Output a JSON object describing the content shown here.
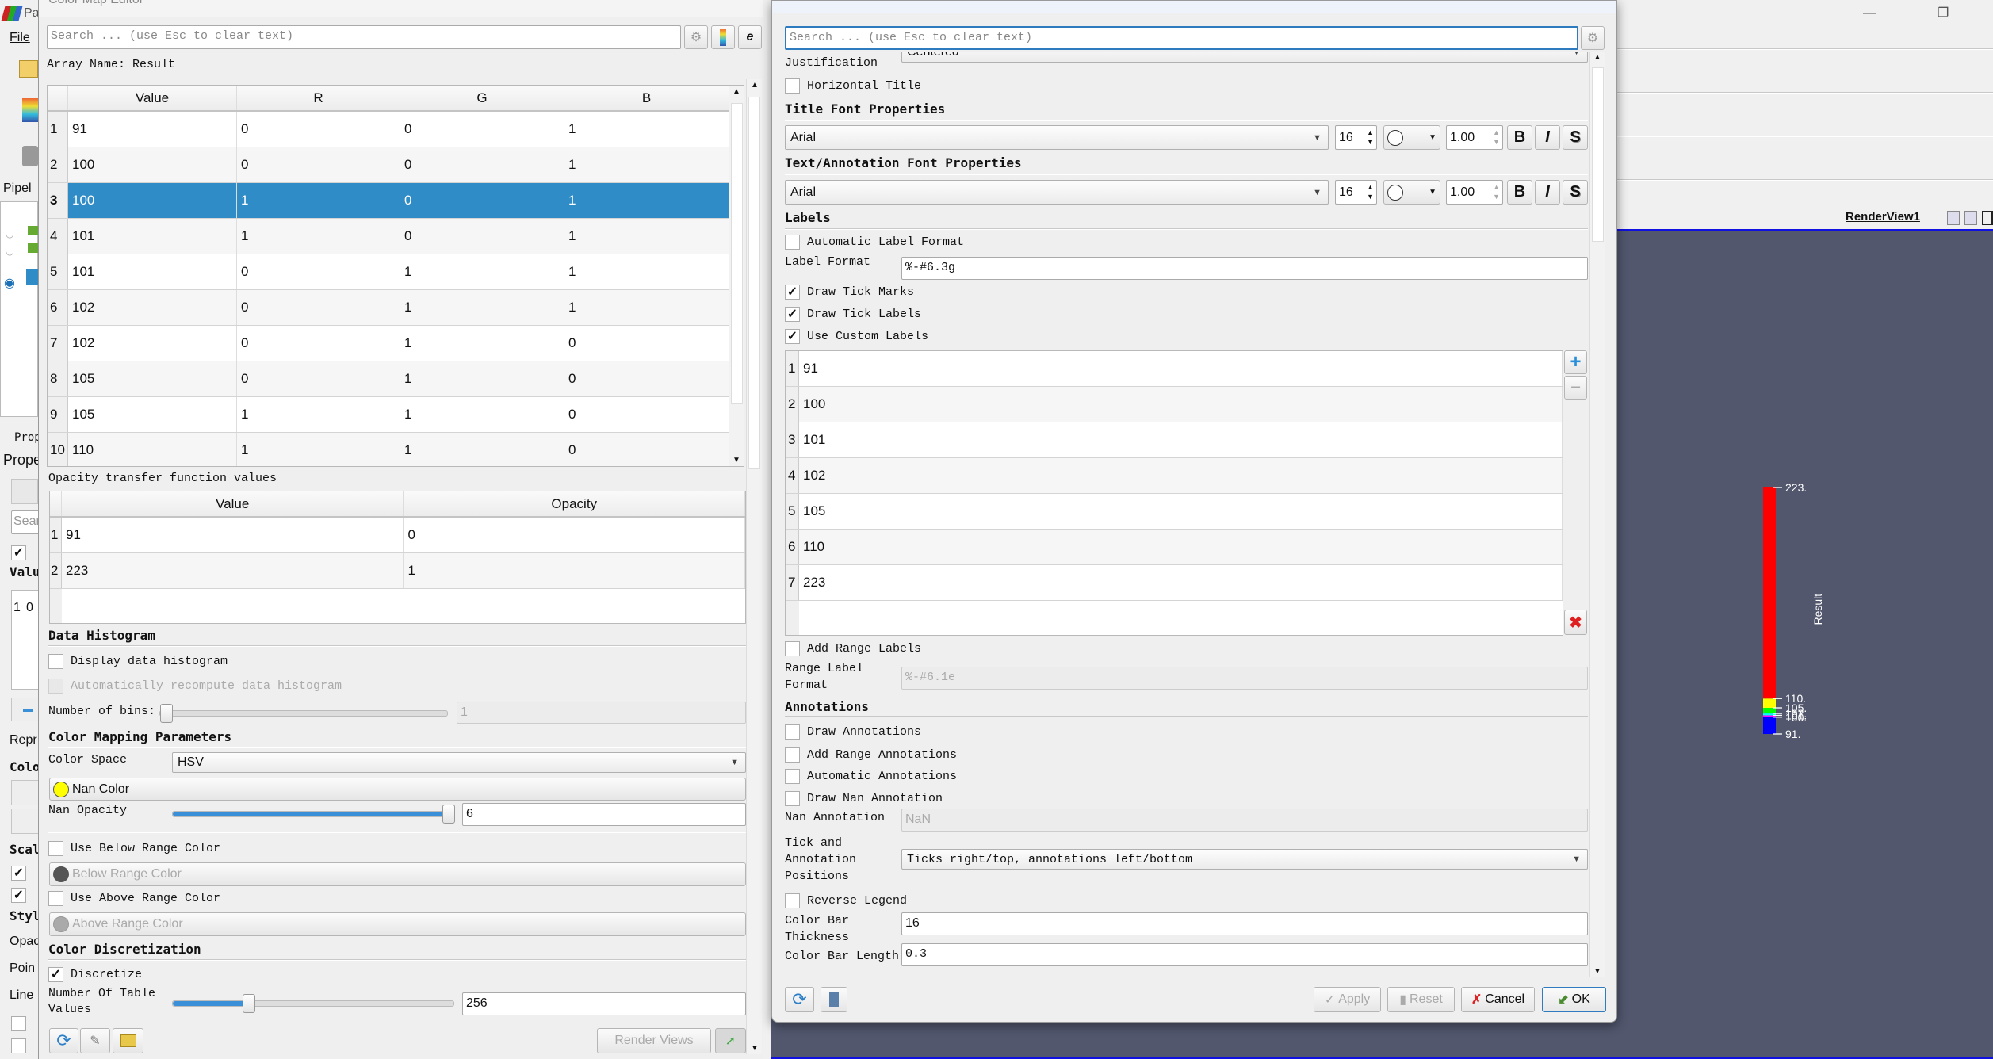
{
  "main_window": {
    "title_fragment": "Pa",
    "menu_file": "File",
    "pipeline_fragment": "Pipel",
    "properties_tab_fragment": "Prop",
    "properties_fragment": "Prope",
    "search_fragment": "Sear",
    "value_fragment": "Valu",
    "mini_row": [
      "1",
      "0"
    ],
    "side_labels": [
      "Repr",
      "Colo",
      "Scal",
      "Styl",
      "Opac",
      "Poin",
      "Line"
    ],
    "render_view_label": "RenderView1",
    "render_bg": "#52576e",
    "colorbar": {
      "title": "Result",
      "range": [
        91,
        223
      ],
      "tick_labels": [
        "223.",
        "110.",
        "105.",
        "102.",
        "101.",
        "100.",
        "91."
      ],
      "tick_values": [
        223,
        110,
        105,
        102,
        101,
        100,
        91
      ],
      "segments": [
        {
          "from": 91,
          "to": 100.3,
          "color": "#0000ff"
        },
        {
          "from": 100.3,
          "to": 101,
          "color": "#ff00ff"
        },
        {
          "from": 101,
          "to": 102,
          "color": "#00ffff"
        },
        {
          "from": 102,
          "to": 105,
          "color": "#00ff00"
        },
        {
          "from": 105,
          "to": 110,
          "color": "#ffff00"
        },
        {
          "from": 110,
          "to": 223,
          "color": "#ff0000"
        }
      ]
    }
  },
  "color_map_editor": {
    "title": "Color Map Editor",
    "search_placeholder": "Search ... (use Esc to clear text)",
    "array_name": "Array Name: Result",
    "table": {
      "headers": [
        "Value",
        "R",
        "G",
        "B"
      ],
      "selected_row": 3,
      "rows": [
        [
          "1",
          "91",
          "0",
          "0",
          "1"
        ],
        [
          "2",
          "100",
          "0",
          "0",
          "1"
        ],
        [
          "3",
          "100",
          "1",
          "0",
          "1"
        ],
        [
          "4",
          "101",
          "1",
          "0",
          "1"
        ],
        [
          "5",
          "101",
          "0",
          "1",
          "1"
        ],
        [
          "6",
          "102",
          "0",
          "1",
          "1"
        ],
        [
          "7",
          "102",
          "0",
          "1",
          "0"
        ],
        [
          "8",
          "105",
          "0",
          "1",
          "0"
        ],
        [
          "9",
          "105",
          "1",
          "1",
          "0"
        ],
        [
          "10",
          "110",
          "1",
          "1",
          "0"
        ]
      ]
    },
    "opacity_label": "Opacity transfer function values",
    "opacity_table": {
      "headers": [
        "Value",
        "Opacity"
      ],
      "rows": [
        [
          "1",
          "91",
          "0"
        ],
        [
          "2",
          "223",
          "1"
        ]
      ]
    },
    "data_histogram": {
      "title": "Data Histogram",
      "display": "Display data histogram",
      "auto_recompute": "Automatically recompute data histogram",
      "bins_label": "Number of bins:",
      "bins_value": "1"
    },
    "color_mapping": {
      "title": "Color Mapping Parameters",
      "color_space_label": "Color Space",
      "color_space": "HSV",
      "nan_color": "Nan Color",
      "nan_color_hex": "#ffff00",
      "nan_opacity_label": "Nan Opacity",
      "nan_opacity": "6",
      "nan_opacity_fraction": 1.0,
      "use_below": "Use Below Range Color",
      "below": "Below Range Color",
      "use_above": "Use Above Range Color",
      "above": "Above Range Color"
    },
    "discretization": {
      "title": "Color Discretization",
      "discretize": "Discretize",
      "discretize_checked": true,
      "table_values_label": "Number Of Table Values",
      "table_values": "256",
      "table_values_fraction": 0.27
    },
    "render_views": "Render Views"
  },
  "color_bar_editor": {
    "search_placeholder": "Search ... (use Esc to clear text)",
    "justification_label": "Justification",
    "justification": "Centered",
    "horizontal_title": "Horizontal Title",
    "title_font": {
      "title": "Title Font Properties",
      "font": "Arial",
      "size": "16",
      "opacity": "1.00"
    },
    "text_font": {
      "title": "Text/Annotation Font Properties",
      "font": "Arial",
      "size": "16",
      "opacity": "1.00"
    },
    "font_buttons": [
      "B",
      "I",
      "S"
    ],
    "labels": {
      "title": "Labels",
      "auto_format": "Automatic Label Format",
      "label_format_label": "Label Format",
      "label_format": "%-#6.3g",
      "draw_tick_marks": "Draw Tick Marks",
      "draw_tick_labels": "Draw Tick Labels",
      "use_custom": "Use Custom Labels",
      "custom_labels": [
        [
          "1",
          "91"
        ],
        [
          "2",
          "100"
        ],
        [
          "3",
          "101"
        ],
        [
          "4",
          "102"
        ],
        [
          "5",
          "105"
        ],
        [
          "6",
          "110"
        ],
        [
          "7",
          "223"
        ]
      ],
      "add_range_labels": "Add Range Labels",
      "range_format_label": "Range Label Format",
      "range_format": "%-#6.1e"
    },
    "annotations": {
      "title": "Annotations",
      "draw": "Draw Annotations",
      "add_range": "Add Range Annotations",
      "automatic": "Automatic Annotations",
      "draw_nan": "Draw Nan Annotation",
      "nan_label": "Nan Annotation",
      "nan_value": "NaN",
      "positions_label": "Tick and Annotation Positions",
      "positions": "Ticks right/top, annotations left/bottom",
      "reverse": "Reverse Legend",
      "thickness_label": "Color Bar Thickness",
      "thickness": "16",
      "length_label": "Color Bar Length",
      "length": "0.3"
    },
    "buttons": {
      "apply": "Apply",
      "reset": "Reset",
      "cancel": "Cancel",
      "ok": "OK"
    }
  }
}
